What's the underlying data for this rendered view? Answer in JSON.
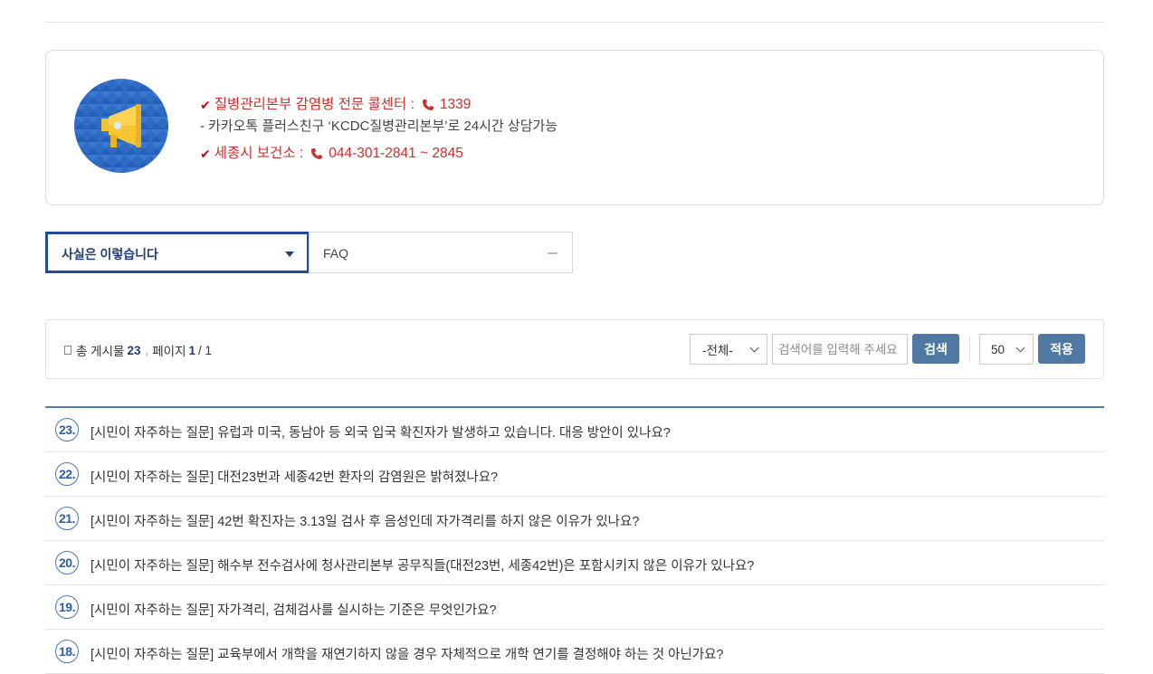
{
  "notice": {
    "line1_label": "질병관리본부 감염병 전문 콜센터 :",
    "line1_phone": "1339",
    "line2_text": "카카오톡 플러스친구 ‘KCDC질병관리본부’로 24시간 상담가능",
    "line3_label": "세종시 보건소 :",
    "line3_phone": "044-301-2841 ~ 2845"
  },
  "tabs": {
    "selected": "사실은 이렇습니다",
    "faq": "FAQ"
  },
  "search": {
    "total_label": "총 게시물",
    "total_count": "23",
    "page_label": "페이지",
    "page_current": "1",
    "page_total": "1",
    "scope_value": "-전체-",
    "keyword_placeholder": "검색어를 입력해 주세요",
    "search_button": "검색",
    "count_value": "50",
    "apply_button": "적용"
  },
  "posts": [
    {
      "num": "23.",
      "title": "[시민이 자주하는 질문] 유럽과 미국, 동남아 등 외국 입국 확진자가 발생하고 있습니다. 대응 방안이 있나요?"
    },
    {
      "num": "22.",
      "title": "[시민이 자주하는 질문] 대전23번과 세종42번 환자의 감염원은 밝혀졌나요?"
    },
    {
      "num": "21.",
      "title": "[시민이 자주하는 질문] 42번 확진자는 3.13일 검사 후 음성인데 자가격리를 하지 않은 이유가 있나요?"
    },
    {
      "num": "20.",
      "title": "[시민이 자주하는 질문] 해수부 전수검사에 청사관리본부 공무직들(대전23번, 세종42번)은 포함시키지 않은 이유가 있나요?"
    },
    {
      "num": "19.",
      "title": "[시민이 자주하는 질문] 자가격리, 검체검사를 실시하는 기준은 무엇인가요?"
    },
    {
      "num": "18.",
      "title": "[시민이 자주하는 질문] 교육부에서 개학을 재연기하지 않을 경우 자체적으로 개학 연기를 결정해야 하는 것 아닌가요?"
    }
  ],
  "colors": {
    "accent": "#1f4e96",
    "button": "#4f79a3",
    "notice_red": "#c9302c",
    "badge": "#2f5f9e"
  }
}
